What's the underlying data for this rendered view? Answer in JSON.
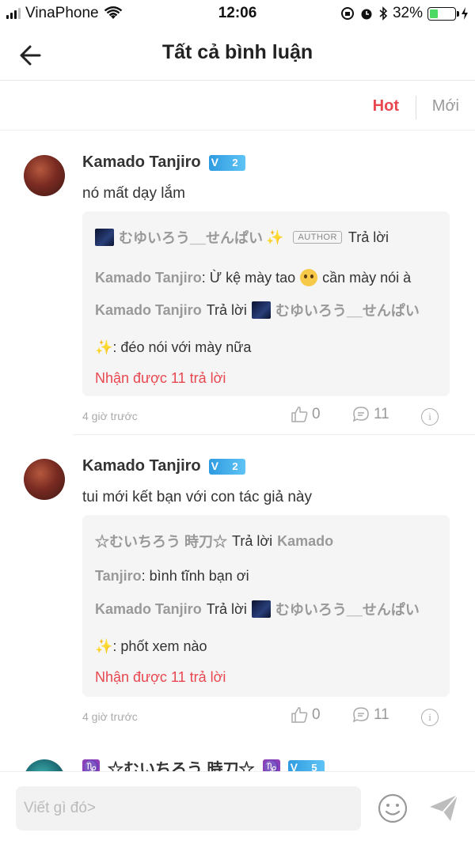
{
  "status_bar": {
    "carrier": "VinaPhone",
    "time": "12:06",
    "battery": "32%"
  },
  "header": {
    "title": "Tất cả bình luận",
    "back_icon": "arrow-left-icon"
  },
  "sort_tabs": {
    "hot": "Hot",
    "new": "Mới",
    "active": "hot",
    "active_color": "#e8474f"
  },
  "comments": [
    {
      "user": "Kamado Tanjiro",
      "level": "2",
      "text": "nó mất dạy lắm",
      "replies": {
        "line1": {
          "name": "むゆいろう__せんぱい",
          "tag": "AUTHOR",
          "action": "Trả lời"
        },
        "line2": {
          "name": "Kamado Tanjiro",
          "text_a": ": Ừ kệ mày tao",
          "text_b": "cần mày nói à"
        },
        "line3": {
          "name": "Kamado Tanjiro",
          "action": "Trả lời",
          "target": "むゆいろう__せんぱい"
        },
        "line4": {
          "text": ": đéo nói với mày nữa"
        },
        "count": "Nhận được 11 trả lời"
      },
      "time": "4 giờ trước",
      "likes": "0",
      "comments": "11"
    },
    {
      "user": "Kamado Tanjiro",
      "level": "2",
      "text": "tui mới kết bạn với con tác giả này",
      "replies": {
        "line1": {
          "name": "☆むいちろう 時刀☆",
          "action": "Trả lời",
          "target": "Kamado"
        },
        "line2": {
          "name": "Tanjiro",
          "text": ": bình tĩnh bạn ơi"
        },
        "line3": {
          "name": "Kamado Tanjiro",
          "action": "Trả lời",
          "target": "むゆいろう__せんぱい"
        },
        "line4": {
          "text": ": phốt xem nào"
        },
        "count": "Nhận được 11 trả lời"
      },
      "time": "4 giờ trước",
      "likes": "0",
      "comments": "11"
    },
    {
      "user": "☆むいちろう 時刀☆",
      "level": "5"
    }
  ],
  "composer": {
    "placeholder": "Viết gì đó>",
    "emoji_icon": "smiley-icon",
    "send_icon": "send-icon"
  }
}
